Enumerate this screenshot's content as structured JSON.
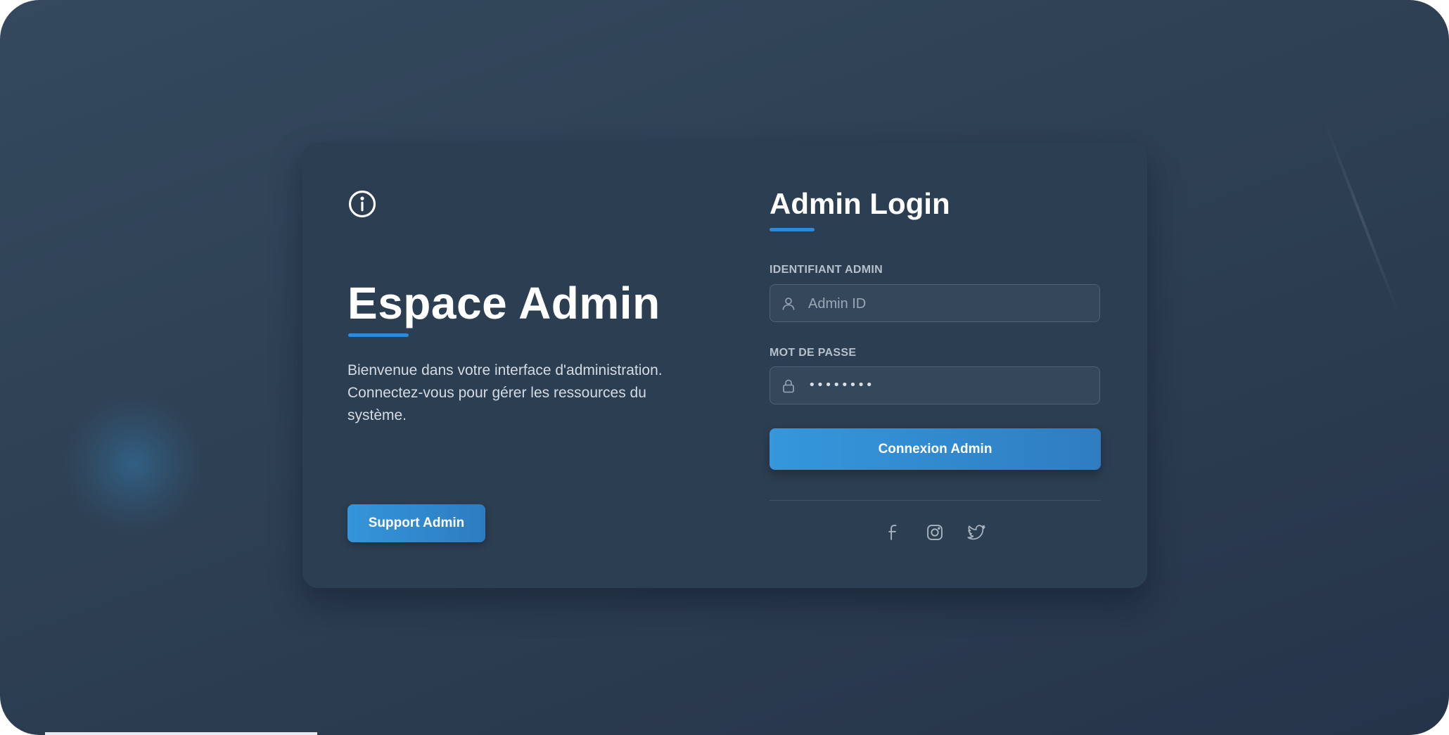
{
  "left_panel": {
    "title": "Espace Admin",
    "description": "Bienvenue dans votre interface d'administration. Connectez-vous pour gérer les ressources du système.",
    "support_button_label": "Support Admin",
    "info_icon": "info-circle-icon"
  },
  "login": {
    "title": "Admin Login",
    "id_label": "IDENTIFIANT ADMIN",
    "id_placeholder": "Admin ID",
    "id_icon": "user-icon",
    "password_label": "MOT DE PASSE",
    "password_value": "••••••••",
    "password_icon": "lock-icon",
    "submit_label": "Connexion Admin"
  },
  "social_icons": [
    "facebook-icon",
    "instagram-icon",
    "twitter-icon"
  ],
  "colors": {
    "background": "#2e4053",
    "card": "#2c3e51",
    "accent": "#2e8ad6",
    "button_start": "#3597dd",
    "button_end": "#2f7dc0"
  }
}
